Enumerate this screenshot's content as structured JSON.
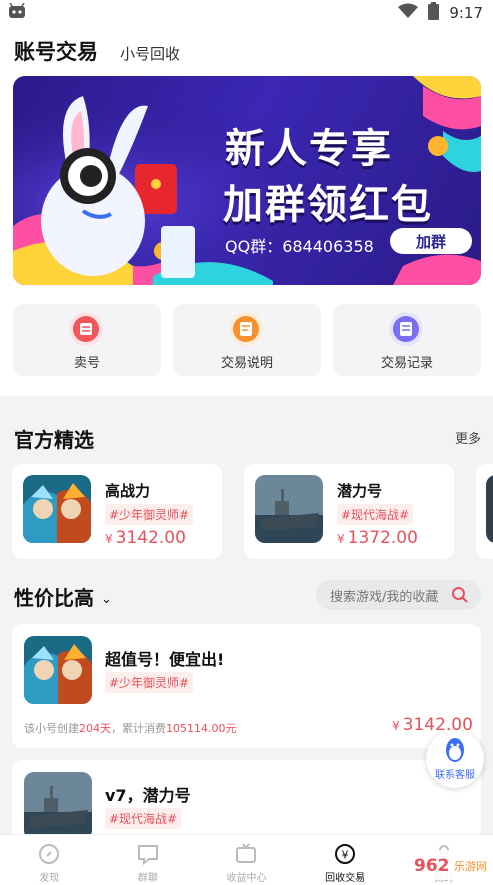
{
  "status_bar": {
    "time": "9:17",
    "left_icon": "android-robot-icon",
    "right_icons": [
      "wifi-icon",
      "battery-icon"
    ]
  },
  "top_tabs": {
    "active": "账号交易",
    "other": "小号回收"
  },
  "banner": {
    "title_line1": "新人专享",
    "title_line2": "加群领红包",
    "qq_text": "QQ群：684406358",
    "join_button": "加群"
  },
  "quick_actions": [
    {
      "label": "卖号",
      "icon": "sell-icon",
      "color": "#f0565c"
    },
    {
      "label": "交易说明",
      "icon": "guide-icon",
      "color": "#f7912f"
    },
    {
      "label": "交易记录",
      "icon": "record-icon",
      "color": "#7b6ef2"
    }
  ],
  "official_picks": {
    "title": "官方精选",
    "more": "更多",
    "items": [
      {
        "name": "高战力",
        "tag": "#少年御灵师#",
        "currency": "¥",
        "price": "3142.00"
      },
      {
        "name": "潜力号",
        "tag": "#现代海战#",
        "currency": "¥",
        "price": "1372.00"
      }
    ]
  },
  "value_section": {
    "title": "性价比高",
    "search_placeholder": "搜索游戏/我的收藏",
    "listings": [
      {
        "title": "超值号！便宜出!",
        "tag": "#少年御灵师#",
        "meta_prefix": "该小号创建",
        "days": "204天",
        "meta_mid": "，累计消费",
        "spent": "105114.00元",
        "currency": "¥",
        "price": "3142.00"
      },
      {
        "title": "v7，潜力号",
        "tag": "#现代海战#"
      }
    ]
  },
  "float_service": {
    "label": "联系客服",
    "icon": "qq-penguin-icon"
  },
  "bottom_nav": [
    {
      "label": "发现",
      "icon": "compass-icon"
    },
    {
      "label": "群聊",
      "icon": "chat-icon"
    },
    {
      "label": "收益中心",
      "icon": "tv-icon"
    },
    {
      "label": "回收交易",
      "icon": "recycle-yen-icon",
      "active": true
    },
    {
      "label": "我的",
      "icon": "user-icon"
    }
  ],
  "watermark": {
    "text1": "962",
    "text2": "乐游网"
  },
  "colors": {
    "accent_red": "#e4535b",
    "banner_bg": "#3b27b4",
    "service_blue": "#3b6ff2"
  }
}
